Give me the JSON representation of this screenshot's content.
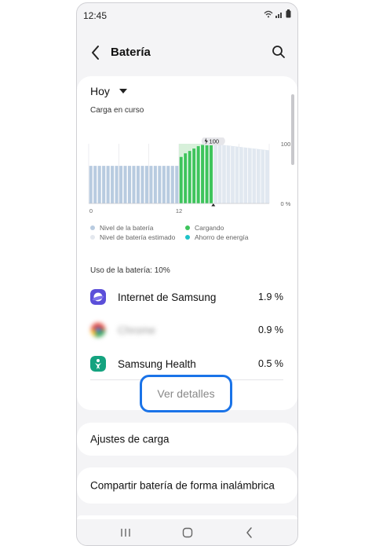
{
  "status_bar": {
    "time": "12:45"
  },
  "header": {
    "title": "Batería"
  },
  "period": {
    "selected": "Hoy"
  },
  "chart_section": {
    "subtitle": "Carga en curso"
  },
  "chart_data": {
    "type": "bar",
    "x_tick_labels": [
      "0",
      "12"
    ],
    "y_tick_labels": [
      "100",
      "0 %"
    ],
    "ylim": [
      0,
      100
    ],
    "annotation": "100",
    "series": [
      {
        "name": "Nivel de la batería",
        "color": "#b8cbe0",
        "slots": 21,
        "values": [
          63,
          63,
          63,
          63,
          63,
          63,
          63,
          63,
          63,
          63,
          63,
          63,
          63,
          63,
          63,
          63,
          63,
          63,
          63,
          63,
          63
        ]
      },
      {
        "name": "Cargando",
        "color": "#3ec45c",
        "slots": 8,
        "values": [
          78,
          84,
          88,
          92,
          96,
          98,
          100,
          100
        ]
      },
      {
        "name": "Nivel de batería estimado",
        "color": "#e1e8f0",
        "slots": 13,
        "values": [
          100,
          99,
          98,
          97,
          96,
          95,
          94,
          94,
          93,
          92,
          91,
          90,
          89
        ]
      }
    ]
  },
  "legend": {
    "items": [
      {
        "label": "Nivel de la batería",
        "color": "#b8cbe0"
      },
      {
        "label": "Cargando",
        "color": "#3ec45c"
      },
      {
        "label": "Nivel de batería estimado",
        "color": "#e4e8ee"
      },
      {
        "label": "Ahorro de energía",
        "color": "#1ec3c8"
      }
    ]
  },
  "usage": {
    "label": "Uso de la batería: 10%",
    "apps": [
      {
        "name": "Internet de Samsung",
        "percent": "1.9 %",
        "icon": "samsung-internet-icon"
      },
      {
        "name": "Chrome",
        "percent": "0.9 %",
        "icon": "chrome-icon"
      },
      {
        "name": "Samsung Health",
        "percent": "0.5 %",
        "icon": "samsung-health-icon"
      }
    ],
    "details_button": "Ver detalles"
  },
  "settings": {
    "charging_settings": "Ajustes de carga",
    "wireless_sharing": "Compartir batería de forma inalámbrica"
  }
}
